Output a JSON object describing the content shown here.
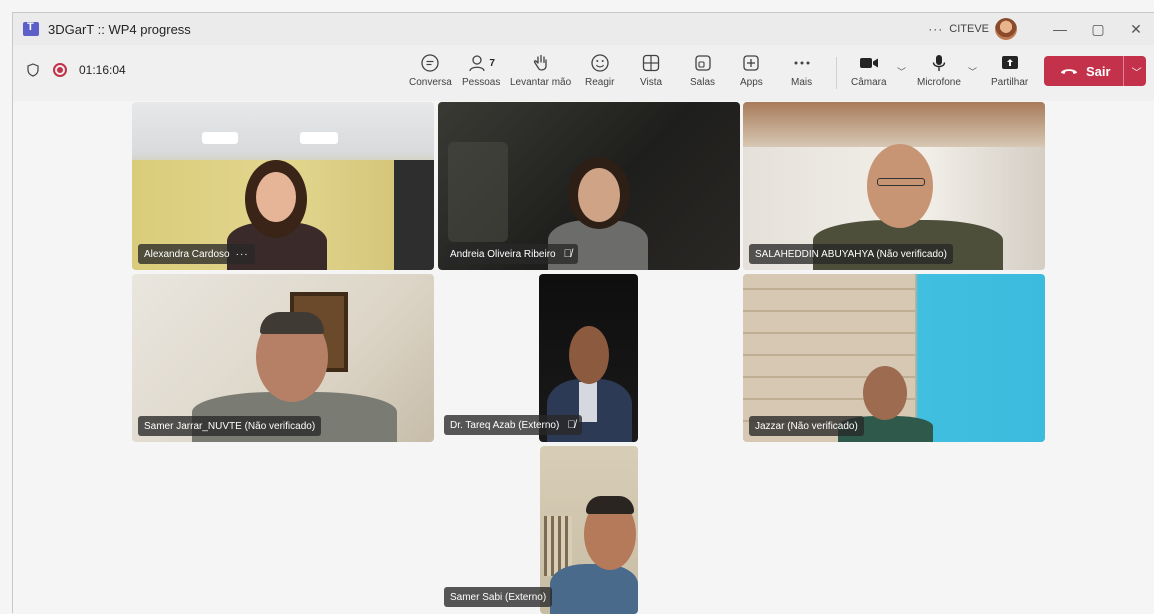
{
  "window": {
    "title": "3DGarT :: WP4 progress",
    "more": "···",
    "org": "CITEVE",
    "minimize": "—",
    "maximize": "▢",
    "close": "✕"
  },
  "meeting": {
    "timer": "01:16:04"
  },
  "toolbar": {
    "chat_label": "Conversa",
    "people_label": "Pessoas",
    "people_count": "7",
    "raise_hand_label": "Levantar mão",
    "react_label": "Reagir",
    "view_label": "Vista",
    "rooms_label": "Salas",
    "apps_label": "Apps",
    "more_label": "Mais",
    "camera_label": "Câmara",
    "mic_label": "Microfone",
    "share_label": "Partilhar",
    "leave_label": "Sair"
  },
  "participants": [
    {
      "name": "Alexandra Cardoso",
      "more": "···"
    },
    {
      "name": "Andreia Oliveira Ribeiro",
      "muted": "🎙̸"
    },
    {
      "name": "SALAHEDDIN ABUYAHYA (Não verificado)"
    },
    {
      "name": "Samer Jarrar_NUVTE (Não verificado)"
    },
    {
      "name": "Dr. Tareq Azab (Externo)",
      "muted": "🎙̸"
    },
    {
      "name": "Jazzar (Não verificado)"
    },
    {
      "name": "Samer Sabi (Externo)"
    }
  ],
  "colors": {
    "accent": "#5b5fc7",
    "leave": "#c4314b",
    "record": "#c4314b"
  }
}
